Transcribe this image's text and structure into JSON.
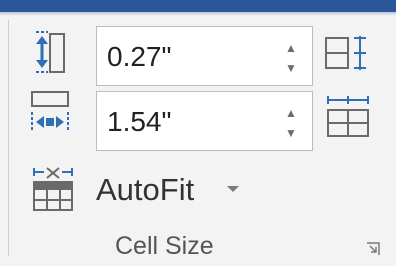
{
  "theme": {
    "accent": "#2b579a",
    "icon_blue": "#2e6fb8",
    "icon_gray": "#6a6a6a"
  },
  "row_height": {
    "value": "0.27\"",
    "icon": "table-row-height-icon"
  },
  "column_width": {
    "value": "1.54\"",
    "icon": "table-column-width-icon"
  },
  "distribute_rows": {
    "icon": "distribute-rows-icon"
  },
  "distribute_columns": {
    "icon": "distribute-columns-icon"
  },
  "autofit": {
    "label": "AutoFit",
    "icon": "autofit-icon"
  },
  "group": {
    "label": "Cell Size",
    "launcher_icon": "dialog-launcher-icon"
  }
}
